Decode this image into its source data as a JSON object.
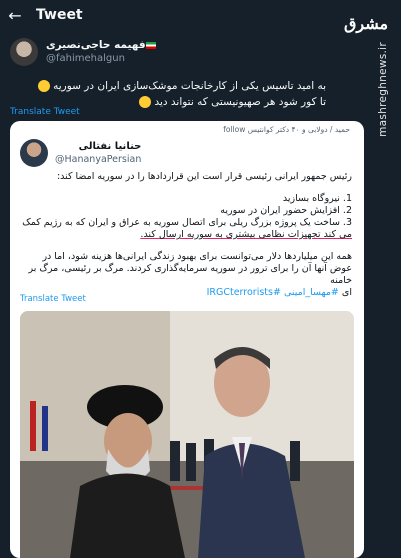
{
  "header": {
    "back_icon": "arrow-left-icon",
    "title": "Tweet"
  },
  "watermark": {
    "logo": "مشرق",
    "url": "mashreghnews.ir"
  },
  "author": {
    "display_name": "فهیمه حاجی‌نصیری",
    "handle": "@fahimehalgun"
  },
  "tweet": {
    "line1": "به امید تاسیس یکی از کارخانجات موشک‌سازی ایران در سوریه",
    "line2": "تا کور شود هر صهیونیستی که نتواند دید",
    "translate": "Translate Tweet"
  },
  "quote": {
    "retweet_line": "حمید / دولابی و ۴۰ دکتر کوانتیس follow",
    "author": {
      "display_name": "حنانیا نفتالی",
      "handle": "@HananyaPersian"
    },
    "intro": "رئیس جمهور ایرانی رئیسی قرار است این قراردادها را در سوریه امضا کند:",
    "items": [
      "1. نیروگاه بسازید",
      "2. افزایش حضور ایران در سوریه",
      "3. ساخت یک پروژه بزرگ ریلی برای اتصال سوریه به عراق و ایران که به رژیم کمک",
      "می کند تجهیزات نظامی بیشتری به سوریه ارسال کند."
    ],
    "outro_line1": "همه این میلیاردها دلار می‌توانست برای بهبود زندگی ایرانی‌ها هزینه شود، اما در",
    "outro_line2": "عوض آنها آن را برای ترور در سوریه سرمایه‌گذاری کردند. مرگ بر رئیسی، مرگ بر خامنه",
    "outro_line3_prefix": "ای",
    "hashtags": "#مهسا_امینی #IRGCterrorists",
    "translate": "Translate Tweet"
  },
  "colors": {
    "background": "#15202b",
    "accent": "#1d9bf0",
    "card": "#ffffff",
    "underline": "#e0245e"
  }
}
